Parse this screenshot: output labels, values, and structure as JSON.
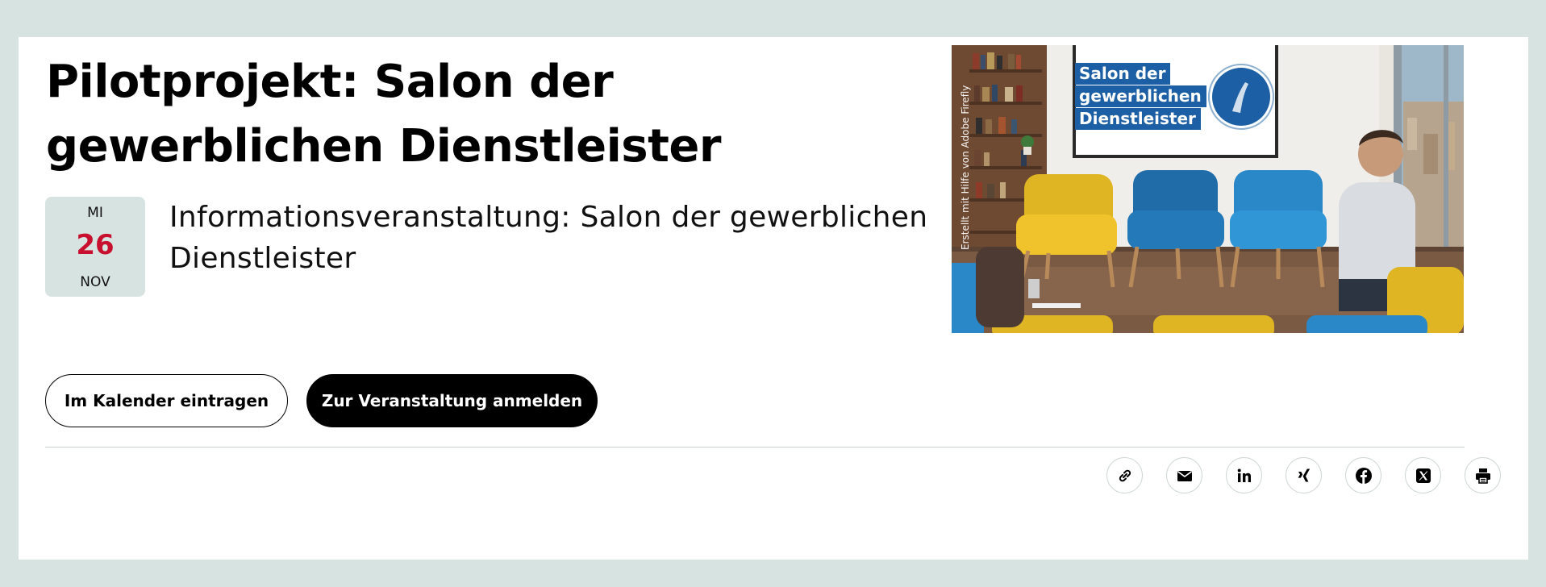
{
  "event": {
    "heading": "Pilotprojekt: Salon der gewerblichen Dienstleister",
    "date": {
      "weekday": "MI",
      "day": "26",
      "month": "NOV"
    },
    "title": "Informationsveranstaltung: Salon der gewerblichen Dienstleister",
    "accent_color": "#c8102e",
    "date_bg_color": "#d7e3e1"
  },
  "actions": {
    "calendar_label": "Im Kalender eintragen",
    "register_label": "Zur Veranstaltung anmelden"
  },
  "image": {
    "credit": "Erstellt mit Hilfe von Adobe Firefly",
    "screen_lines": [
      "Salon der",
      "gewerblichen",
      "Dienstleister"
    ],
    "screen_color": "#1c5fa4"
  },
  "share": [
    {
      "name": "copy-link",
      "icon": "link-icon"
    },
    {
      "name": "email",
      "icon": "mail-icon"
    },
    {
      "name": "linkedin",
      "icon": "linkedin-icon"
    },
    {
      "name": "xing",
      "icon": "xing-icon"
    },
    {
      "name": "facebook",
      "icon": "facebook-icon"
    },
    {
      "name": "x",
      "icon": "x-icon"
    },
    {
      "name": "print",
      "icon": "printer-icon"
    }
  ]
}
